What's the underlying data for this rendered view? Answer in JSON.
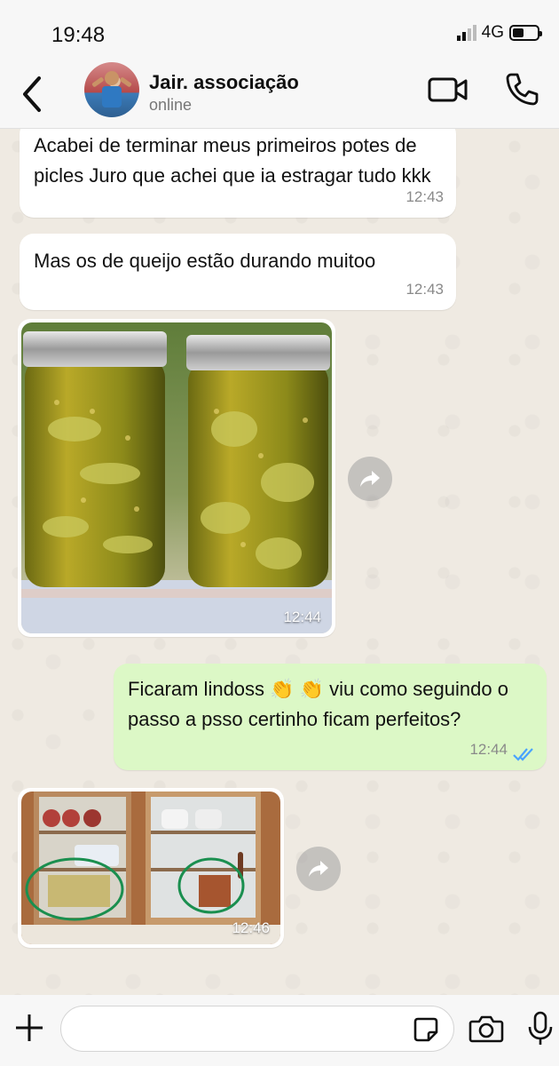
{
  "status_bar": {
    "time": "19:48",
    "network": "4G",
    "battery_level": 0.45
  },
  "header": {
    "name": "Jair. associação",
    "status": "online"
  },
  "messages": [
    {
      "type": "text",
      "dir": "in",
      "text": "Acabei de terminar meus primeiros potes de picles Juro que achei que ia estragar tudo kkk",
      "time": "12:43"
    },
    {
      "type": "text",
      "dir": "in",
      "text": "Mas os de queijo estão durando muitoo",
      "time": "12:43"
    },
    {
      "type": "image",
      "dir": "in",
      "time": "12:44",
      "subject": "two-pickle-jars-photo"
    },
    {
      "type": "text",
      "dir": "out",
      "text": "Ficaram lindoss 👏 👏 viu como seguindo o passo a psso certinho ficam perfeitos?",
      "time": "12:44",
      "read_icon": "double-check-icon"
    },
    {
      "type": "image",
      "dir": "in",
      "time": "12:46",
      "subject": "kitchen-cabinet-photo"
    }
  ],
  "composer": {
    "placeholder": ""
  },
  "colors": {
    "outgoing_bubble": "#dcf8c6",
    "incoming_bubble": "#ffffff",
    "read_tick": "#4aa3ff",
    "circle_markup": "#1a8f4f"
  }
}
